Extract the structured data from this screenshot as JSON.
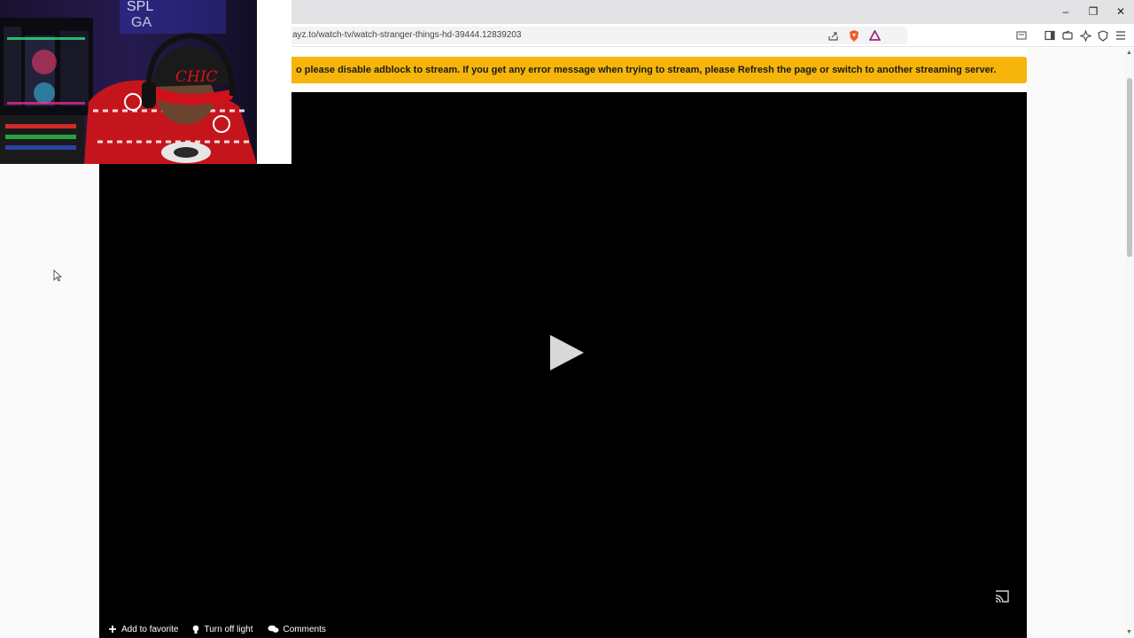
{
  "browser": {
    "url": "ayz.to/watch-tv/watch-stranger-things-hd-39444.12839203",
    "window_controls": [
      "minimize",
      "restore",
      "close"
    ]
  },
  "banner": {
    "text": "o please disable adblock to stream. If you get any error message when trying to stream, please Refresh the page or switch to another streaming server.",
    "color": "#f5b50a"
  },
  "player": {
    "background": "#000000",
    "actions": {
      "add_favorite": "Add to favorite",
      "turn_off_light": "Turn off light",
      "comments": "Comments"
    }
  },
  "webcam": {
    "hat_text": "CHIC"
  },
  "icons": {
    "play": "play-icon",
    "cast": "cast-icon",
    "plus": "plus-icon",
    "bulb": "lightbulb-icon",
    "comments": "comments-icon"
  }
}
